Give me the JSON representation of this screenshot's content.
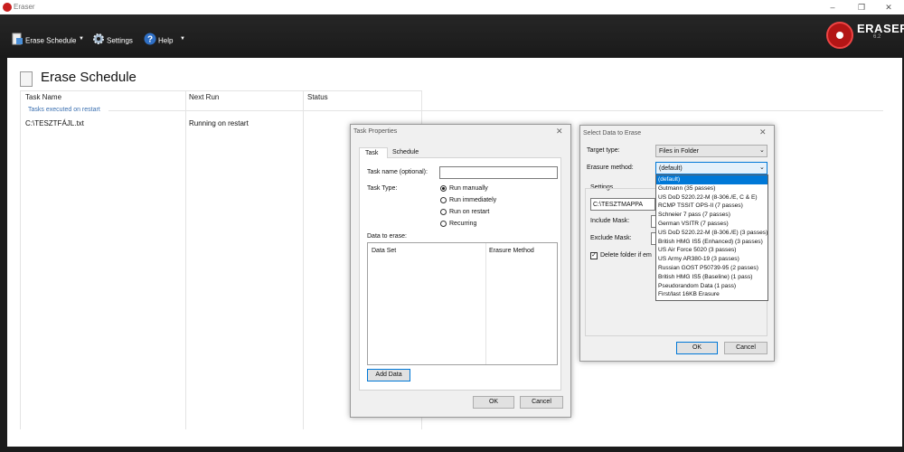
{
  "window": {
    "title": "Eraser",
    "minimize": "–",
    "maximize": "❐",
    "close": "✕"
  },
  "toolbar": {
    "erase_schedule": "Erase Schedule",
    "settings": "Settings",
    "help": "Help",
    "dropdown_glyph": "▼",
    "brand": "ERASER",
    "version": "6.2"
  },
  "main": {
    "title": "Erase Schedule",
    "columns": [
      "Task Name",
      "Next Run",
      "Status"
    ],
    "group_label": "Tasks executed on restart",
    "rows": [
      {
        "task": "C:\\TESZTFÁJL.txt",
        "next_run": "Running on restart",
        "status": ""
      }
    ]
  },
  "task_props": {
    "title": "Task Properties",
    "tabs": [
      "Task",
      "Schedule"
    ],
    "task_name_label": "Task name (optional):",
    "task_name_value": "",
    "task_type_label": "Task Type:",
    "options": [
      "Run manually",
      "Run immediately",
      "Run on restart",
      "Recurring"
    ],
    "selected_option": "Run manually",
    "data_label": "Data to erase:",
    "data_cols": [
      "Data Set",
      "Erasure Method"
    ],
    "add_data": "Add Data",
    "ok": "OK",
    "cancel": "Cancel"
  },
  "select_data": {
    "title": "Select Data to Erase",
    "target_type_label": "Target type:",
    "target_type_value": "Files in Folder",
    "method_label": "Erasure method:",
    "method_value": "(default)",
    "settings_label": "Settings",
    "folder_value": "C:\\TESZTMAPPA",
    "include_mask": "Include Mask:",
    "exclude_mask": "Exclude Mask:",
    "delete_folder": "Delete folder if em",
    "ok": "OK",
    "cancel": "Cancel",
    "methods": [
      "(default)",
      "Gutmann (35 passes)",
      "US DoD 5220.22-M (8-306./E, C & E)",
      "RCMP TSSIT OPS-II (7 passes)",
      "Schneier 7 pass (7 passes)",
      "German VSITR (7 passes)",
      "US DoD 5220.22-M (8-306./E) (3 passes)",
      "British HMG IS5 (Enhanced) (3 passes)",
      "US Air Force 5020 (3 passes)",
      "US Army AR380-19 (3 passes)",
      "Russian GOST P50739-95 (2 passes)",
      "British HMG IS5 (Baseline) (1 pass)",
      "Pseudorandom Data (1 pass)",
      "First/last 16KB Erasure"
    ],
    "selected_method": "(default)"
  },
  "colors": {
    "accent": "#0078d7",
    "toolbar": "#1f1f1f",
    "brand_red": "#b31515",
    "group_label": "#3a6fb0"
  }
}
